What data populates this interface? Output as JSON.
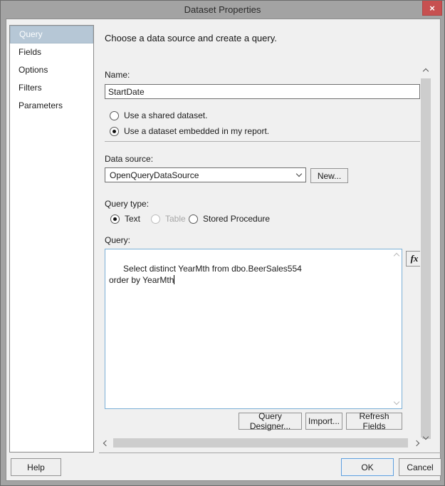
{
  "window": {
    "title": "Dataset Properties",
    "close_glyph": "×"
  },
  "sidebar": {
    "items": [
      {
        "label": "Query",
        "selected": true
      },
      {
        "label": "Fields",
        "selected": false
      },
      {
        "label": "Options",
        "selected": false
      },
      {
        "label": "Filters",
        "selected": false
      },
      {
        "label": "Parameters",
        "selected": false
      }
    ]
  },
  "main": {
    "heading": "Choose a data source and create a query.",
    "name": {
      "label": "Name:",
      "value": "StartDate"
    },
    "dataset_mode": {
      "shared_label": "Use a shared dataset.",
      "embedded_label": "Use a dataset embedded in my report.",
      "selected": "embedded"
    },
    "data_source": {
      "label": "Data source:",
      "value": "OpenQueryDataSource",
      "new_button_label": "New..."
    },
    "query_type": {
      "label": "Query type:",
      "options": [
        {
          "label": "Text",
          "state": "selected"
        },
        {
          "label": "Table",
          "state": "disabled"
        },
        {
          "label": "Stored Procedure",
          "state": "normal"
        }
      ]
    },
    "query": {
      "label": "Query:",
      "text": "Select distinct YearMth from dbo.BeerSales554\norder by YearMth",
      "fx_button_label": "fx"
    },
    "actions": {
      "query_designer_label": "Query Designer...",
      "import_label": "Import...",
      "refresh_fields_label": "Refresh Fields"
    }
  },
  "footer": {
    "help_label": "Help",
    "ok_label": "OK",
    "cancel_label": "Cancel"
  },
  "colors": {
    "selected_item_bg": "#b6c7d6",
    "close_button": "#c75050",
    "ok_focus_border": "#5f9edb",
    "query_focus_border": "#7aafd6",
    "content_bg": "#f0f0f0",
    "titlebar_bg": "#a3a3a3"
  }
}
